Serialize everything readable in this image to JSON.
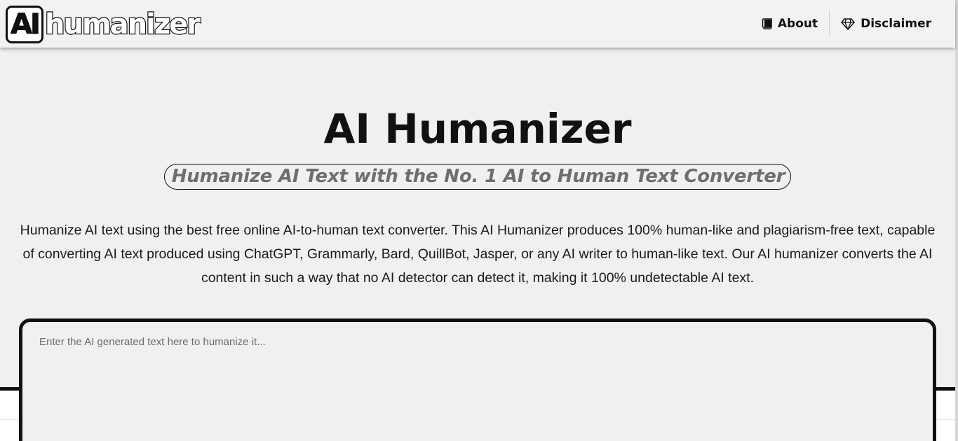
{
  "header": {
    "logo_badge": "AI",
    "logo_text": "humanizer",
    "nav": [
      {
        "label": "About",
        "icon": "book-icon"
      },
      {
        "label": "Disclaimer",
        "icon": "diamond-icon"
      }
    ]
  },
  "hero": {
    "title": "AI Humanizer",
    "subtitle": "Humanize AI Text with the No. 1 AI to Human Text Converter",
    "description": "Humanize AI text using the best free online AI-to-human text converter. This AI Humanizer produces 100% human-like and plagiarism-free text, capable of converting AI text produced using ChatGPT, Grammarly, Bard, QuillBot, Jasper, or any AI writer to human-like text. Our AI humanizer converts the AI content in such a way that no AI detector can detect it, making it 100% undetectable AI text."
  },
  "input": {
    "placeholder": "Enter the AI generated text here to humanize it...",
    "value": ""
  },
  "colors": {
    "background": "#f0f0f0",
    "text": "#111111",
    "subtitle": "#6e6e6e"
  }
}
